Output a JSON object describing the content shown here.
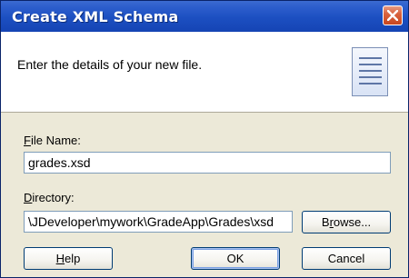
{
  "window": {
    "title": "Create XML Schema"
  },
  "header": {
    "description": "Enter the details of your new file."
  },
  "form": {
    "file_name_label_mnemonic": "F",
    "file_name_label_rest": "ile Name:",
    "file_name_value": "grades.xsd",
    "directory_label_mnemonic": "D",
    "directory_label_rest": "irectory:",
    "directory_value": "\\JDeveloper\\mywork\\GradeApp\\Grades\\xsd"
  },
  "buttons": {
    "browse_pre": "B",
    "browse_mnemonic": "r",
    "browse_post": "owse...",
    "help_mnemonic": "H",
    "help_post": "elp",
    "ok": "OK",
    "cancel": "Cancel"
  },
  "icons": {
    "close": "close-icon",
    "header": "document-icon"
  },
  "colors": {
    "titlebar": "#1c4fc1",
    "close_button": "#d9633f",
    "dialog_background": "#ece9d8"
  }
}
